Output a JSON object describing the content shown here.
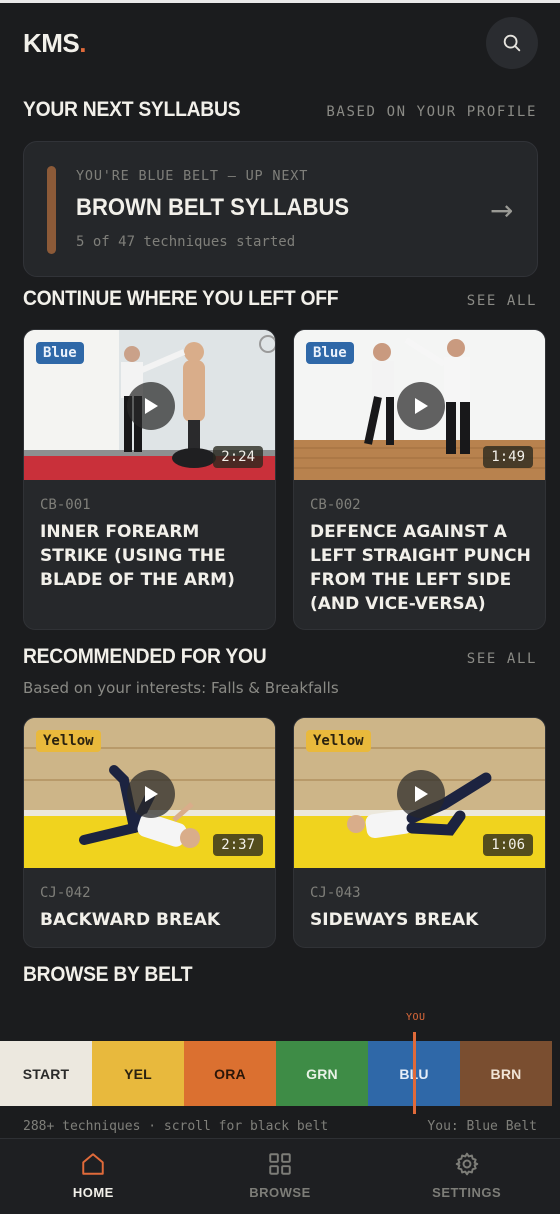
{
  "app": {
    "logo": "KMS",
    "logo_dot": "."
  },
  "syllabus_section": {
    "title": "YOUR NEXT SYLLABUS",
    "link": "BASED ON YOUR PROFILE",
    "card": {
      "eyebrow": "YOU'RE BLUE BELT — UP NEXT",
      "title": "BROWN BELT SYLLABUS",
      "subtitle": "5 of 47 techniques started",
      "accent_color": "#8c5a38"
    }
  },
  "continue_section": {
    "title": "CONTINUE WHERE YOU LEFT OFF",
    "link": "SEE ALL",
    "cards": [
      {
        "badge": "Blue",
        "duration": "2:24",
        "code": "CB-001",
        "title": "INNER FOREARM STRIKE (USING THE BLADE OF THE ARM)"
      },
      {
        "badge": "Blue",
        "duration": "1:49",
        "code": "CB-002",
        "title": "DEFENCE AGAINST A LEFT STRAIGHT PUNCH FROM THE LEFT SIDE (AND VICE-VERSA)"
      }
    ]
  },
  "recommended_section": {
    "title": "RECOMMENDED FOR YOU",
    "link": "SEE ALL",
    "subtitle": "Based on your interests: Falls & Breakfalls",
    "cards": [
      {
        "badge": "Yellow",
        "duration": "2:37",
        "code": "CJ-042",
        "title": "BACKWARD BREAK"
      },
      {
        "badge": "Yellow",
        "duration": "1:06",
        "code": "CJ-043",
        "title": "SIDEWAYS BREAK"
      }
    ]
  },
  "browse_section": {
    "title": "BROWSE BY BELT",
    "you_label": "YOU",
    "belts": [
      {
        "label": "START",
        "color": "#ece8df",
        "text_color": "#2a2a2a"
      },
      {
        "label": "YEL",
        "color": "#e8b93d",
        "text_color": "#2a2210"
      },
      {
        "label": "ORA",
        "color": "#db7030",
        "text_color": "#2a1608"
      },
      {
        "label": "GRN",
        "color": "#3e8c46",
        "text_color": "#e8f2e6"
      },
      {
        "label": "BLU",
        "color": "#2f68a8",
        "text_color": "#e6eef8"
      },
      {
        "label": "BRN",
        "color": "#7a4e30",
        "text_color": "#f0e4d6"
      }
    ],
    "footer_left": "288+ techniques · scroll for black belt",
    "footer_right": "You: Blue Belt"
  },
  "nav": {
    "home": "HOME",
    "browse": "BROWSE",
    "settings": "SETTINGS"
  },
  "colors": {
    "accent": "#e06a3a",
    "background": "#1b1c1e",
    "card": "#26282b"
  }
}
